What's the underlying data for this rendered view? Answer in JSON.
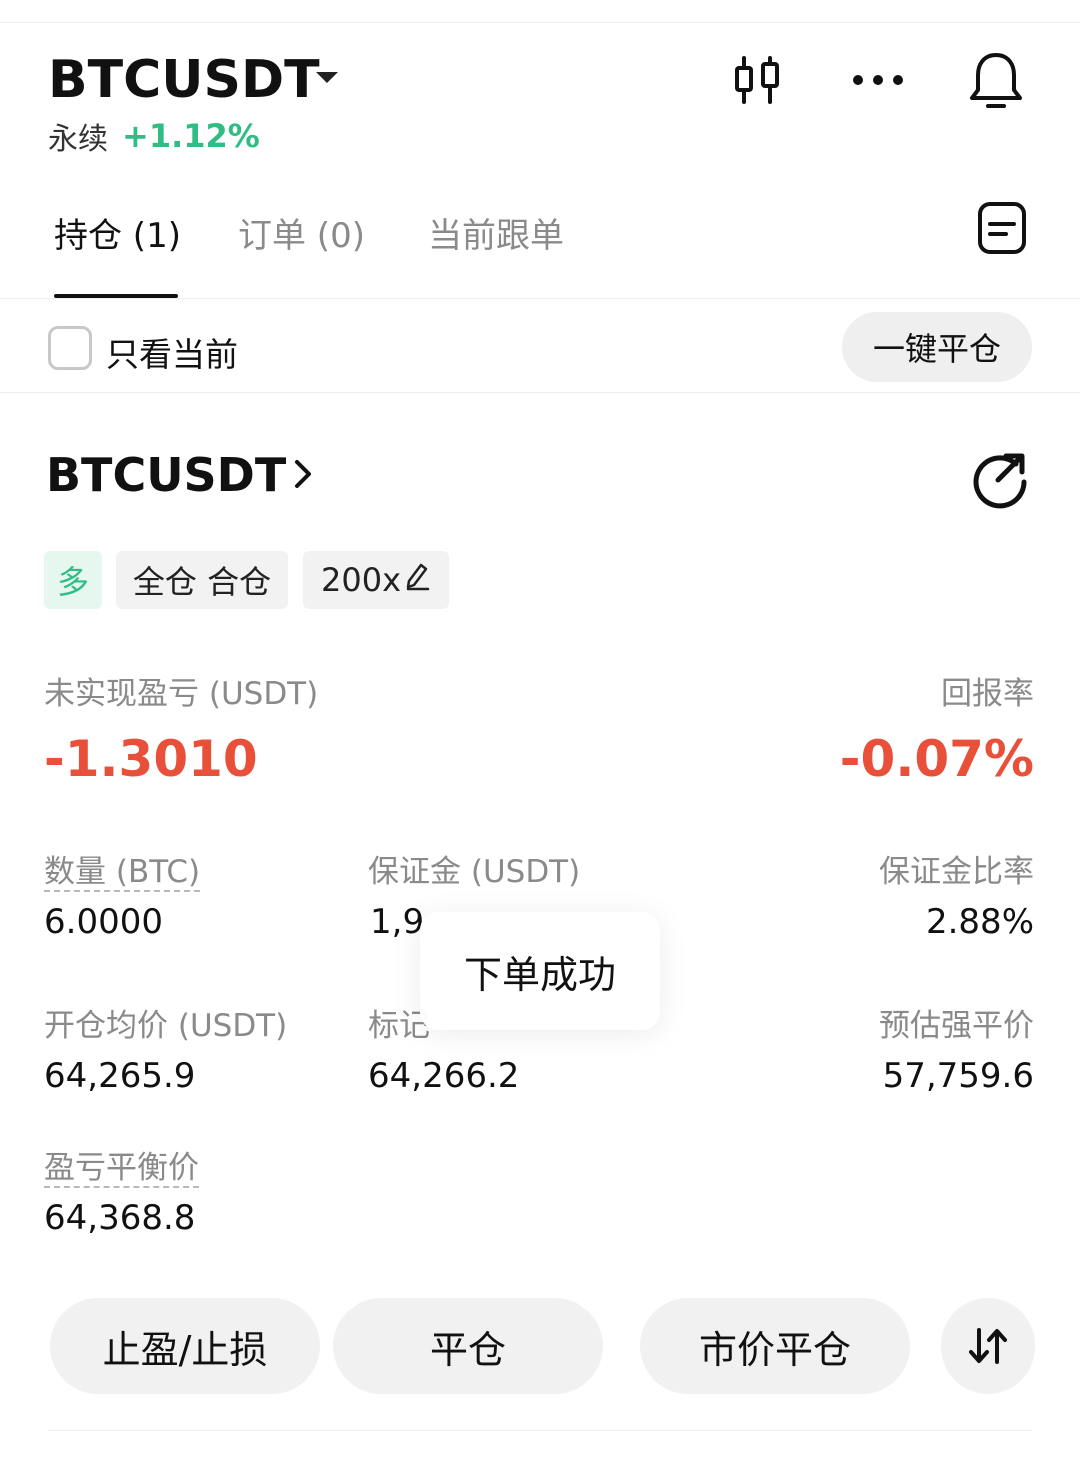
{
  "header": {
    "symbol": "BTCUSDT",
    "contract_type": "永续",
    "change_pct": "+1.12%",
    "icons": [
      "candlestick-chart-icon",
      "more-icon",
      "bell-icon"
    ]
  },
  "tabs": [
    {
      "label": "持仓 (1)",
      "active": true
    },
    {
      "label": "订单 (0)",
      "active": false
    },
    {
      "label": "当前跟单",
      "active": false
    }
  ],
  "filter": {
    "only_current_label": "只看当前",
    "only_current_checked": false,
    "close_all_label": "一键平仓"
  },
  "position": {
    "symbol": "BTCUSDT",
    "side_tag": "多",
    "margin_mode_tag": "全仓 合仓",
    "leverage_tag": "200x",
    "unrealized_pnl_label": "未实现盈亏 (USDT)",
    "unrealized_pnl_value": "-1.3010",
    "roe_label": "回报率",
    "roe_value": "-0.07%",
    "qty_label": "数量 (BTC)",
    "qty_value": "6.0000",
    "margin_label": "保证金 (USDT)",
    "margin_value": "1,9",
    "margin_ratio_label": "保证金比率",
    "margin_ratio_value": "2.88%",
    "entry_price_label": "开仓均价 (USDT)",
    "entry_price_value": "64,265.9",
    "mark_price_label": "标记",
    "mark_price_value": "64,266.2",
    "liq_price_label": "预估强平价",
    "liq_price_value": "57,759.6",
    "breakeven_label": "盈亏平衡价",
    "breakeven_value": "64,368.8"
  },
  "toast": {
    "text": "下单成功"
  },
  "actions": {
    "tp_sl": "止盈/止损",
    "close": "平仓",
    "market_close": "市价平仓",
    "reverse_icon": "swap-vertical-icon"
  },
  "colors": {
    "up_green": "#2fbd85",
    "down_red": "#e8503a",
    "muted_text": "#8a8a8a",
    "button_bg": "#f1f1f1"
  }
}
